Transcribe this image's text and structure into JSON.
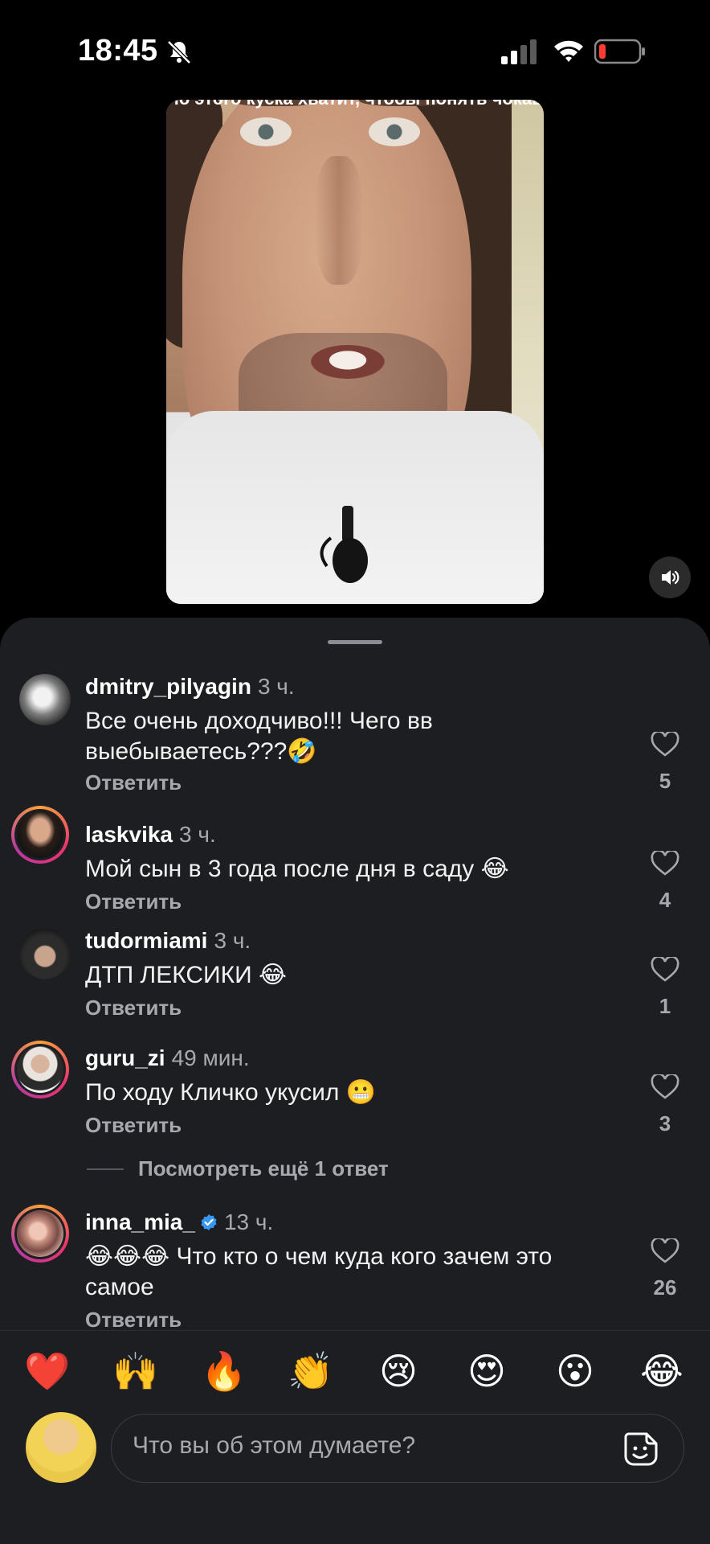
{
  "status_bar": {
    "time": "18:45"
  },
  "video": {
    "caption": "По этого куска хватит, чтобы понять чокаво"
  },
  "comments": [
    {
      "username": "dmitry_pilyagin",
      "ago": "3 ч.",
      "text": "Все очень доходчиво!!! Чего вв выебываетесь???🤣",
      "reply": "Ответить",
      "likes": "5"
    },
    {
      "username": "laskvika",
      "ago": "3 ч.",
      "text": "Мой сын в 3 года после дня в саду 😂",
      "reply": "Ответить",
      "likes": "4"
    },
    {
      "username": "tudormiami",
      "ago": "3 ч.",
      "text": "ДТП ЛЕКСИКИ 😂",
      "reply": "Ответить",
      "likes": "1"
    },
    {
      "username": "guru_zi",
      "ago": "49 мин.",
      "text": "По ходу Кличко укусил 😬",
      "reply": "Ответить",
      "likes": "3"
    },
    {
      "username": "inna_mia_",
      "ago": "13 ч.",
      "text": "😂😂😂 Что кто о чем куда кого зачем это самое",
      "reply": "Ответить",
      "likes": "26"
    }
  ],
  "more_replies": "Посмотреть ещё 1 ответ",
  "emoji_bar": [
    "❤️",
    "🙌",
    "🔥",
    "👏",
    "😢",
    "😍",
    "😮",
    "😂"
  ],
  "input": {
    "placeholder": "Что вы об этом думаете?"
  },
  "colors": {
    "sheet_bg": "#1c1e22",
    "muted_text": "#a7a9ae",
    "verified_blue": "#3897f0"
  }
}
